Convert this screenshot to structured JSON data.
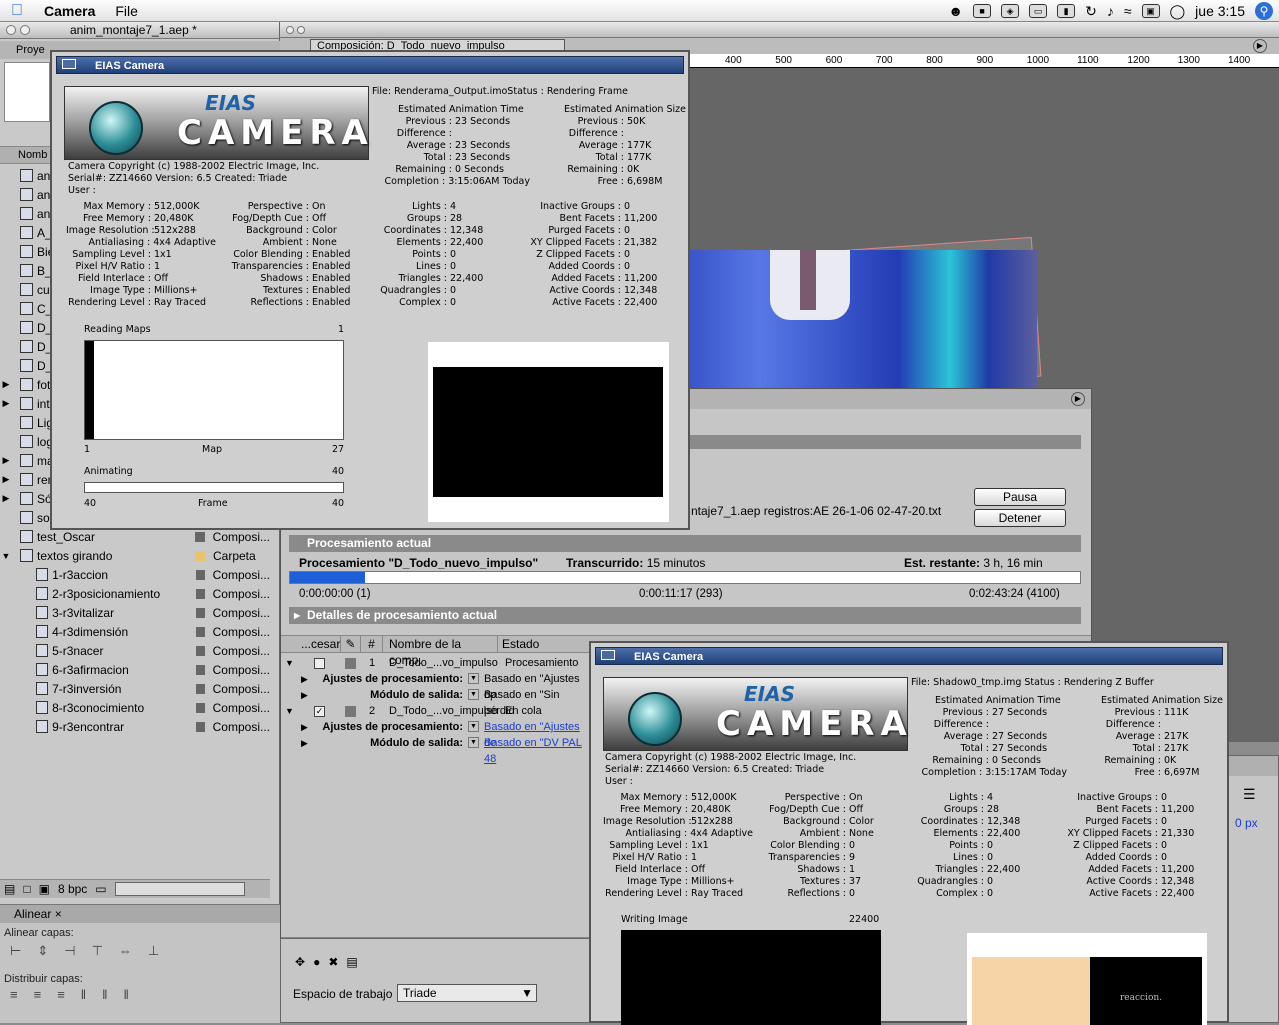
{
  "menubar": {
    "app": "Camera",
    "file": "File",
    "clock": "jue 3:15"
  },
  "project_window": {
    "title": "anim_montaje7_1.aep *",
    "panel_tab": "Proye",
    "col_name": "Nomb",
    "items": [
      {
        "name": "ani",
        "type": ""
      },
      {
        "name": "ani",
        "type": ""
      },
      {
        "name": "ani",
        "type": ""
      },
      {
        "name": "A_I",
        "type": ""
      },
      {
        "name": "Bie",
        "type": ""
      },
      {
        "name": "B_I",
        "type": ""
      },
      {
        "name": "cub",
        "type": ""
      },
      {
        "name": "C_a",
        "type": ""
      },
      {
        "name": "D_",
        "type": ""
      },
      {
        "name": "D_",
        "type": ""
      },
      {
        "name": "D_",
        "type": ""
      },
      {
        "name": "fot",
        "type": ""
      },
      {
        "name": "intr",
        "type": ""
      },
      {
        "name": "Lig",
        "type": ""
      },
      {
        "name": "log",
        "type": ""
      },
      {
        "name": "ma",
        "type": ""
      },
      {
        "name": "ren",
        "type": ""
      },
      {
        "name": "Sól",
        "type": ""
      },
      {
        "name": "sor",
        "type": ""
      },
      {
        "name": "test_Oscar",
        "type": "Composi..."
      },
      {
        "name": "textos girando",
        "type": "Carpeta"
      },
      {
        "name": "1-r3accion",
        "type": "Composi..."
      },
      {
        "name": "2-r3posicionamiento",
        "type": "Composi..."
      },
      {
        "name": "3-r3vitalizar",
        "type": "Composi..."
      },
      {
        "name": "4-r3dimensión",
        "type": "Composi..."
      },
      {
        "name": "5-r3nacer",
        "type": "Composi..."
      },
      {
        "name": "6-r3afirmacion",
        "type": "Composi..."
      },
      {
        "name": "7-r3inversión",
        "type": "Composi..."
      },
      {
        "name": "8-r3conocimiento",
        "type": "Composi..."
      },
      {
        "name": "9-r3encontrar",
        "type": "Composi..."
      }
    ],
    "bpc": "8 bpc"
  },
  "align_panel": {
    "tab": "Alinear",
    "align_label": "Alinear capas:",
    "distribute_label": "Distribuir capas:"
  },
  "comp_window": {
    "tab": "Composición: D_Todo_nuevo_impulso",
    "ruler": [
      "400",
      "500",
      "600",
      "700",
      "800",
      "900",
      "1000",
      "1100",
      "1200",
      "1300",
      "1400"
    ]
  },
  "render_queue": {
    "log": "ntaje7_1.aep registros:AE 26-1-06 02-47-20.txt",
    "pause": "Pausa",
    "stop": "Detener",
    "current_header": "Procesamiento actual",
    "rendering_label": "Procesamiento \"D_Todo_nuevo_impulso\"",
    "elapsed": "Transcurrido: 15 minutos",
    "remaining": "Est. restante: 3 h, 16 min",
    "progress": 0.095,
    "t_start": "0:00:00:00 (1)",
    "t_current": "0:00:11:17 (293)",
    "t_end": "0:02:43:24 (4100)",
    "details": "Detalles de procesamiento actual",
    "columns": [
      "...cesar",
      "#",
      "Nombre de la comp.",
      "Estado"
    ],
    "items": [
      {
        "num": "1",
        "name": "D_Todo_...vo_impulso",
        "status": "Procesamiento",
        "settings_label": "Ajustes de procesamiento:",
        "settings": "Basado en \"Ajustes óp",
        "output_label": "Módulo de salida:",
        "output": "Basado en \"Sin pérdid"
      },
      {
        "num": "2",
        "name": "D_Todo_...vo_impulso",
        "status": "En cola",
        "settings_label": "Ajustes de procesamiento:",
        "settings": "Basado en \"Ajustes de",
        "output_label": "Módulo de salida:",
        "output": "Basado en \"DV PAL 48"
      }
    ],
    "workspace_label": "Espacio de trabajo",
    "workspace": "Triade",
    "px": "0 px"
  },
  "eias1": {
    "title": "EIAS Camera",
    "logo_top": "EIAS",
    "logo_main": "CAMERA",
    "file": "File:  Renderama_Output.imoStatus : Rendering Frame",
    "time_head": "Estimated Animation Time",
    "size_head": "Estimated Animation Size",
    "time": [
      [
        "Previous :",
        "23 Seconds"
      ],
      [
        "Difference :",
        ""
      ],
      [
        "Average :",
        "23 Seconds"
      ],
      [
        "Total :",
        "23 Seconds"
      ],
      [
        "Remaining :",
        "0 Seconds"
      ],
      [
        "Completion :",
        "3:15:06AM Today"
      ]
    ],
    "size": [
      [
        "Previous :",
        "50K"
      ],
      [
        "Difference :",
        ""
      ],
      [
        "Average :",
        "177K"
      ],
      [
        "Total :",
        "177K"
      ],
      [
        "Remaining :",
        "0K"
      ],
      [
        "Free :",
        "6,698M"
      ]
    ],
    "copy": "Camera Copyright (c) 1988-2002 Electric Image, Inc.",
    "serial": "Serial#:     ZZ14660   Version:  6.5     Created:   Triade",
    "user": "User :",
    "stats1": [
      [
        "Max Memory :",
        "512,000K"
      ],
      [
        "Free Memory :",
        "20,480K"
      ],
      [
        "Image Resolution :",
        "512x288"
      ],
      [
        "Antialiasing :",
        "4x4 Adaptive"
      ],
      [
        "Sampling Level :",
        "1x1"
      ],
      [
        "Pixel H/V Ratio :",
        "1"
      ],
      [
        "Field Interlace :",
        "Off"
      ],
      [
        "Image Type :",
        "Millions+"
      ],
      [
        "Rendering Level :",
        "Ray Traced"
      ]
    ],
    "stats2": [
      [
        "Perspective :",
        "On"
      ],
      [
        "Fog/Depth Cue :",
        "Off"
      ],
      [
        "Background :",
        "Color"
      ],
      [
        "Ambient :",
        "None"
      ],
      [
        "Color Blending :",
        "Enabled"
      ],
      [
        "Transparencies :",
        "Enabled"
      ],
      [
        "Shadows :",
        "Enabled"
      ],
      [
        "Textures :",
        "Enabled"
      ],
      [
        "Reflections :",
        "Enabled"
      ]
    ],
    "stats3": [
      [
        "Lights :",
        "4"
      ],
      [
        "Groups :",
        "28"
      ],
      [
        "Coordinates :",
        "12,348"
      ],
      [
        "Elements :",
        "22,400"
      ],
      [
        "Points :",
        "0"
      ],
      [
        "Lines :",
        "0"
      ],
      [
        "Triangles :",
        "22,400"
      ],
      [
        "Quadrangles :",
        "0"
      ],
      [
        "Complex :",
        "0"
      ]
    ],
    "stats4": [
      [
        "Inactive Groups :",
        "0"
      ],
      [
        "Bent Facets :",
        "11,200"
      ],
      [
        "Purged Facets :",
        "0"
      ],
      [
        "XY Clipped Facets :",
        "21,382"
      ],
      [
        "Z Clipped Facets :",
        "0"
      ],
      [
        "Added Coords :",
        "0"
      ],
      [
        "Added Facets :",
        "11,200"
      ],
      [
        "Active Coords :",
        "12,348"
      ],
      [
        "Active Facets :",
        "22,400"
      ]
    ],
    "maps_label": "Reading Maps",
    "maps_val": "1",
    "map_min": "1",
    "map_mid": "Map",
    "map_max": "27",
    "anim_label": "Animating",
    "anim_val": "40",
    "frame_min": "40",
    "frame_mid": "Frame",
    "frame_max": "40"
  },
  "eias2": {
    "title": "EIAS Camera",
    "logo_top": "EIAS",
    "logo_main": "CAMERA",
    "file": "File:  Shadow0_tmp.img      Status : Rendering Z Buffer",
    "time_head": "Estimated Animation Time",
    "size_head": "Estimated Animation Size",
    "time": [
      [
        "Previous :",
        "27 Seconds"
      ],
      [
        "Difference :",
        ""
      ],
      [
        "Average :",
        "27 Seconds"
      ],
      [
        "Total :",
        "27 Seconds"
      ],
      [
        "Remaining :",
        "0 Seconds"
      ],
      [
        "Completion :",
        "3:15:17AM Today"
      ]
    ],
    "size": [
      [
        "Previous :",
        "111K"
      ],
      [
        "Difference :",
        ""
      ],
      [
        "Average :",
        "217K"
      ],
      [
        "Total :",
        "217K"
      ],
      [
        "Remaining :",
        "0K"
      ],
      [
        "Free :",
        "6,697M"
      ]
    ],
    "copy": "Camera Copyright (c) 1988-2002 Electric Image, Inc.",
    "serial": "Serial#:     ZZ14660   Version:  6.5     Created:   Triade",
    "user": "User :",
    "stats1": [
      [
        "Max Memory :",
        "512,000K"
      ],
      [
        "Free Memory :",
        "20,480K"
      ],
      [
        "Image Resolution :",
        "512x288"
      ],
      [
        "Antialiasing :",
        "4x4 Adaptive"
      ],
      [
        "Sampling Level :",
        "1x1"
      ],
      [
        "Pixel H/V Ratio :",
        "1"
      ],
      [
        "Field Interlace :",
        "Off"
      ],
      [
        "Image Type :",
        "Millions+"
      ],
      [
        "Rendering Level :",
        "Ray Traced"
      ]
    ],
    "stats2": [
      [
        "Perspective :",
        "On"
      ],
      [
        "Fog/Depth Cue :",
        "Off"
      ],
      [
        "Background :",
        "Color"
      ],
      [
        "Ambient :",
        "None"
      ],
      [
        "Color Blending :",
        "0"
      ],
      [
        "Transparencies :",
        "9"
      ],
      [
        "Shadows :",
        "1"
      ],
      [
        "Textures :",
        "37"
      ],
      [
        "Reflections :",
        "0"
      ]
    ],
    "stats3": [
      [
        "Lights :",
        "4"
      ],
      [
        "Groups :",
        "28"
      ],
      [
        "Coordinates :",
        "12,348"
      ],
      [
        "Elements :",
        "22,400"
      ],
      [
        "Points :",
        "0"
      ],
      [
        "Lines :",
        "0"
      ],
      [
        "Triangles :",
        "22,400"
      ],
      [
        "Quadrangles :",
        "0"
      ],
      [
        "Complex :",
        "0"
      ]
    ],
    "stats4": [
      [
        "Inactive Groups :",
        "0"
      ],
      [
        "Bent Facets :",
        "11,200"
      ],
      [
        "Purged Facets :",
        "0"
      ],
      [
        "XY Clipped Facets :",
        "21,330"
      ],
      [
        "Z Clipped Facets :",
        "0"
      ],
      [
        "Added Coords :",
        "0"
      ],
      [
        "Added Facets :",
        "11,200"
      ],
      [
        "Active Coords :",
        "12,348"
      ],
      [
        "Active Facets :",
        "22,400"
      ]
    ],
    "writing_label": "Writing Image",
    "writing_val": "22400",
    "thumb_text": "reaccion."
  }
}
